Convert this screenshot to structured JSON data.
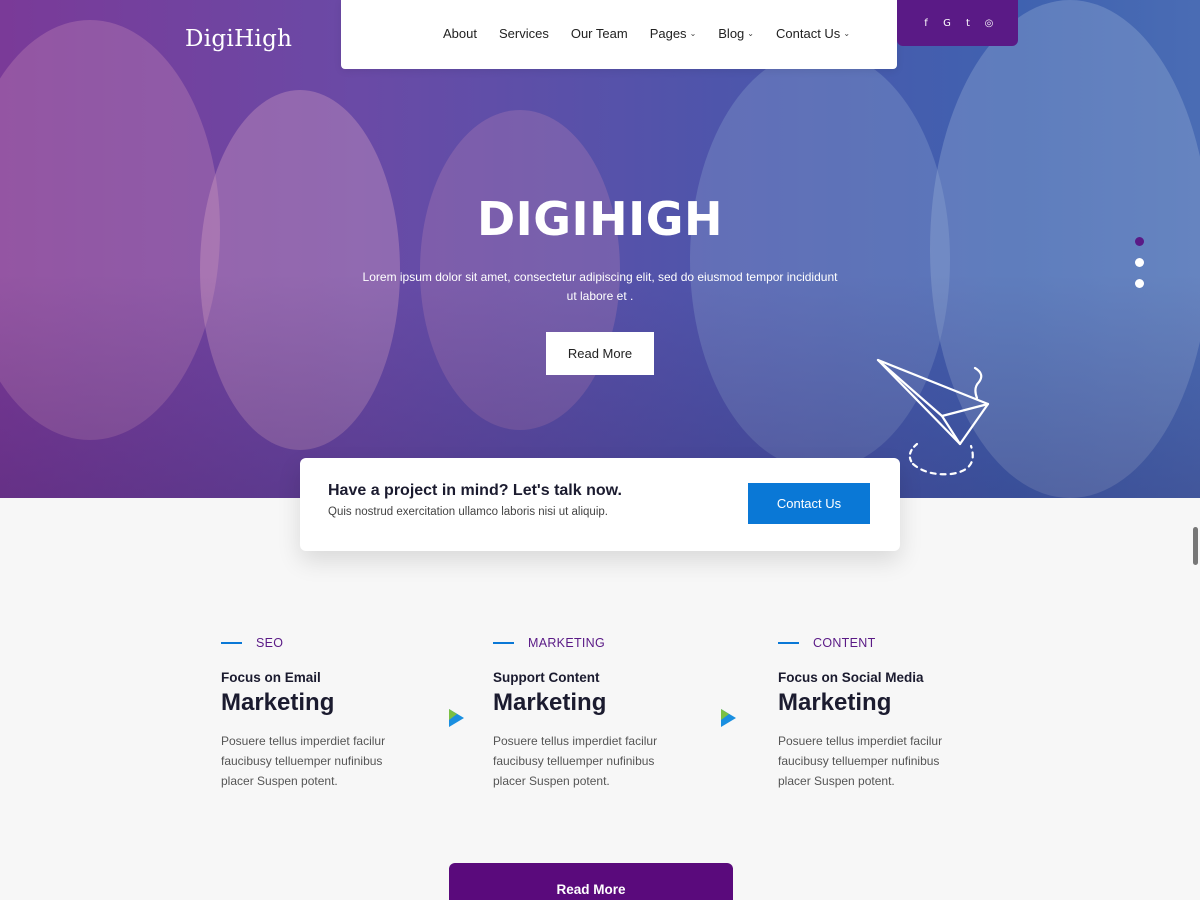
{
  "brand": {
    "logo": "DigiHigh"
  },
  "nav": {
    "items": [
      {
        "label": "About",
        "dropdown": false
      },
      {
        "label": "Services",
        "dropdown": false
      },
      {
        "label": "Our Team",
        "dropdown": false
      },
      {
        "label": "Pages",
        "dropdown": true
      },
      {
        "label": "Blog",
        "dropdown": true
      },
      {
        "label": "Contact Us",
        "dropdown": true
      }
    ],
    "chevron": "⌄"
  },
  "social": {
    "icons": [
      "facebook-icon",
      "google-plus-icon",
      "twitter-icon",
      "instagram-icon"
    ],
    "glyphs": [
      "f",
      "G",
      "t",
      "◎"
    ]
  },
  "hero": {
    "title": "DIGIHIGH",
    "subtitle": "Lorem ipsum dolor sit amet, consectetur adipiscing elit, sed do eiusmod tempor incididunt ut labore et .",
    "button": "Read More",
    "slides": 3,
    "active_slide": 0
  },
  "cta": {
    "heading": "Have a project in mind? Let's talk now.",
    "text": "Quis nostrud exercitation ullamco laboris nisi ut aliquip.",
    "button": "Contact Us"
  },
  "features": [
    {
      "tag": "SEO",
      "subtitle": "Focus on Email",
      "title": "Marketing",
      "text": "Posuere tellus imperdiet facilur faucibusy telluemper nufinibus placer Suspen potent."
    },
    {
      "tag": "MARKETING",
      "subtitle": "Support Content",
      "title": "Marketing",
      "text": "Posuere tellus imperdiet facilur faucibusy telluemper nufinibus placer Suspen potent."
    },
    {
      "tag": "CONTENT",
      "subtitle": "Focus on Social Media",
      "title": "Marketing",
      "text": "Posuere tellus imperdiet facilur faucibusy telluemper nufinibus placer Suspen potent."
    }
  ],
  "bottom_button": "Read More",
  "colors": {
    "brand_purple": "#5a1a86",
    "accent_blue": "#0a78d6",
    "hero_gradient_left": "#7a3a98",
    "hero_gradient_right": "#4a6cb4"
  }
}
